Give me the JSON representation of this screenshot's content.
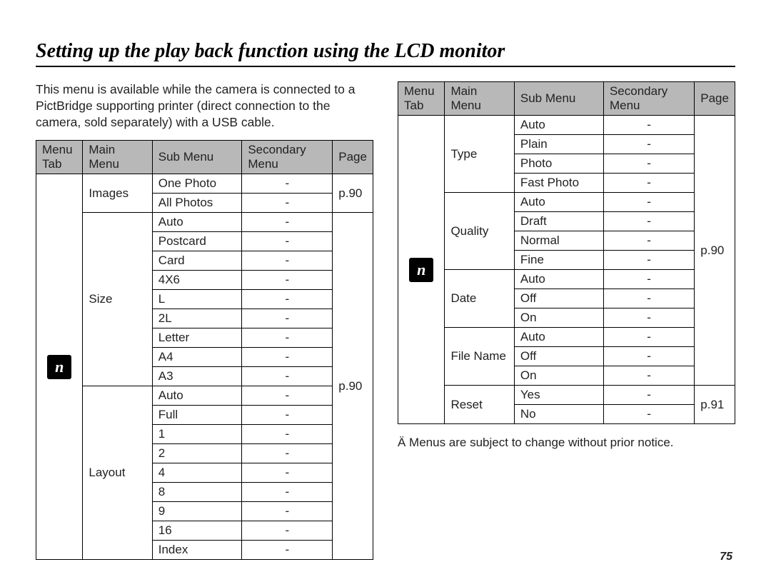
{
  "heading": "Setting up the play back function using the LCD monitor",
  "intro": "This menu is available while the camera is connected to a PictBridge supporting printer (direct connection to the camera, sold separately) with a USB cable.",
  "headers": {
    "tab": "Menu Tab",
    "main": "Main Menu",
    "sub": "Sub Menu",
    "sec": "Secondary Menu",
    "page": "Page"
  },
  "table1": {
    "groups": [
      {
        "main": "Images",
        "page": "p.90",
        "subs": [
          "One Photo",
          "All Photos"
        ]
      },
      {
        "main": "Size",
        "page": "p.90",
        "subs": [
          "Auto",
          "Postcard",
          "Card",
          "4X6",
          "L",
          "2L",
          "Letter",
          "A4",
          "A3"
        ]
      },
      {
        "main": "Layout",
        "page": "",
        "subs": [
          "Auto",
          "Full",
          "1",
          "2",
          "4",
          "8",
          "9",
          "16",
          "Index"
        ]
      }
    ]
  },
  "table2": {
    "groups": [
      {
        "main": "Type",
        "page": "p.90",
        "subs": [
          "Auto",
          "Plain",
          "Photo",
          "Fast Photo"
        ]
      },
      {
        "main": "Quality",
        "page": "",
        "subs": [
          "Auto",
          "Draft",
          "Normal",
          "Fine"
        ]
      },
      {
        "main": "Date",
        "page": "",
        "subs": [
          "Auto",
          "Off",
          "On"
        ]
      },
      {
        "main": "File Name",
        "page": "",
        "subs": [
          "Auto",
          "Off",
          "On"
        ]
      },
      {
        "main": "Reset",
        "page": "p.91",
        "subs": [
          "Yes",
          "No"
        ]
      }
    ]
  },
  "footnote": "Ä Menus are subject to change without prior notice.",
  "page_number": "75"
}
